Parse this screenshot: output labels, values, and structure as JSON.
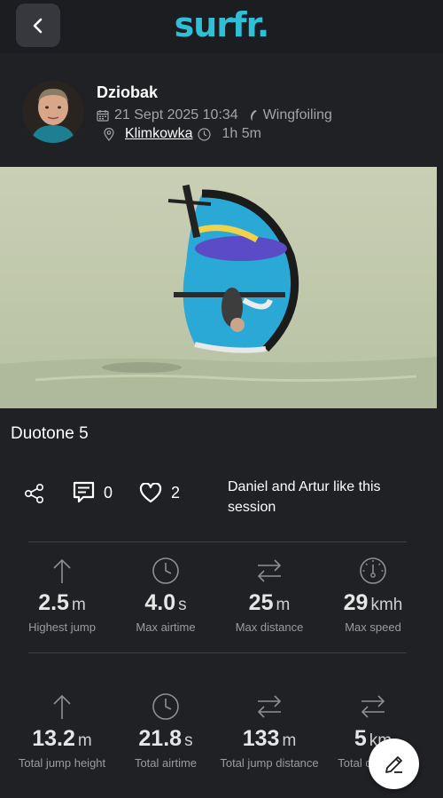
{
  "app": {
    "logo_text": "surfr."
  },
  "session": {
    "user_name": "Dziobak",
    "date": "21 Sept 2025 10:34",
    "sport": "Wingfoiling",
    "location": "Klimkowka",
    "duration": "1h 5m",
    "gear": "Duotone 5"
  },
  "social": {
    "comments_count": "0",
    "likes_count": "2",
    "likes_text": "Daniel and Artur like this session"
  },
  "stats_primary": [
    {
      "icon": "arrow-up-icon",
      "value": "2.5",
      "unit": "m",
      "label": "Highest jump"
    },
    {
      "icon": "clock-icon",
      "value": "4.0",
      "unit": "s",
      "label": "Max airtime"
    },
    {
      "icon": "arrows-swap-icon",
      "value": "25",
      "unit": "m",
      "label": "Max distance"
    },
    {
      "icon": "speedometer-icon",
      "value": "29",
      "unit": "kmh",
      "label": "Max speed"
    }
  ],
  "stats_total": [
    {
      "icon": "arrow-up-icon",
      "value": "13.2",
      "unit": "m",
      "label": "Total jump height"
    },
    {
      "icon": "clock-icon",
      "value": "21.8",
      "unit": "s",
      "label": "Total airtime"
    },
    {
      "icon": "arrows-swap-icon",
      "value": "133",
      "unit": "m",
      "label": "Total jump distance"
    },
    {
      "icon": "arrows-swap-icon",
      "value": "5",
      "unit": "km",
      "label": "Total distance"
    }
  ],
  "colors": {
    "background": "#202125",
    "brand": "#2fc0d8",
    "muted_text": "#a3a4a8"
  }
}
